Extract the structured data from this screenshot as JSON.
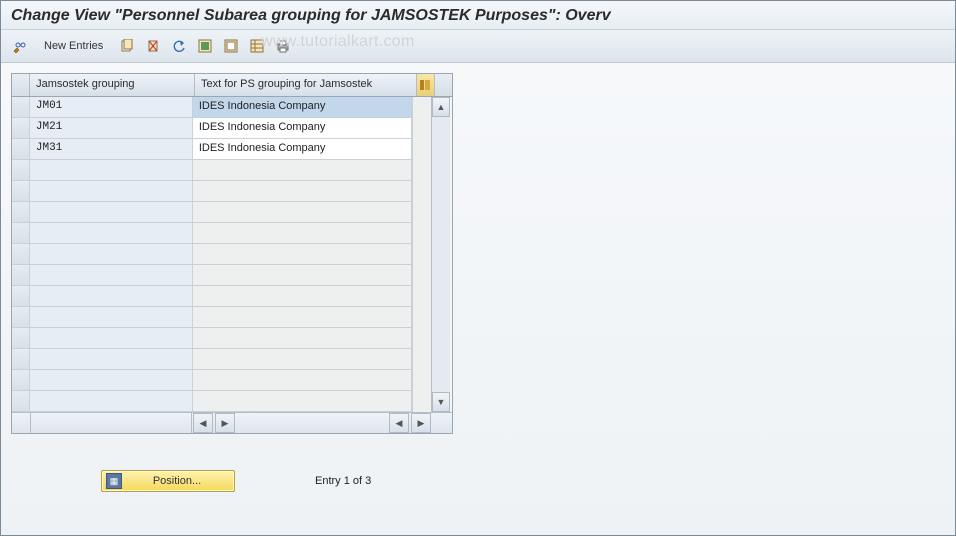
{
  "title": "Change View \"Personnel Subarea grouping for JAMSOSTEK Purposes\": Overv",
  "watermark": "www.tutorialkart.com",
  "toolbar": {
    "new_entries": "New Entries"
  },
  "grid": {
    "columns": {
      "c1": "Jamsostek grouping",
      "c2": "Text for PS grouping for Jamsostek"
    },
    "rows": [
      {
        "code": "JM01",
        "text": "IDES Indonesia Company",
        "selected": true
      },
      {
        "code": "JM21",
        "text": "IDES Indonesia Company",
        "selected": false
      },
      {
        "code": "JM31",
        "text": "IDES Indonesia Company",
        "selected": false
      }
    ],
    "empty_rows": 12
  },
  "footer": {
    "position_label": "Position...",
    "entry_label": "Entry 1 of 3"
  }
}
